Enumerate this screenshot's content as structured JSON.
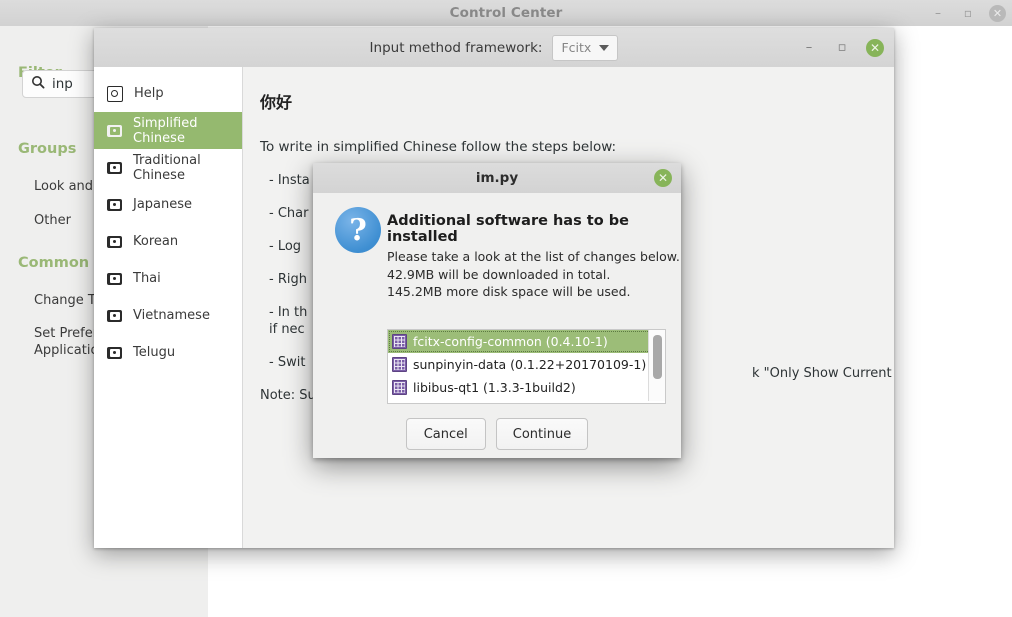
{
  "control_center": {
    "title": "Control Center",
    "window_controls": {
      "minimize": "–",
      "maximize": "▫",
      "close": "✕"
    },
    "sidebar": {
      "filter_label": "Filter",
      "search": {
        "icon": "search-icon",
        "value": "inp",
        "placeholder": ""
      },
      "groups_label": "Groups",
      "group_items": [
        {
          "label": "Look and F"
        },
        {
          "label": "Other"
        }
      ],
      "common_label": "Common T",
      "common_items": [
        {
          "label": "Change Th"
        },
        {
          "label": "Set Prefer"
        },
        {
          "label": "Applicatio"
        }
      ]
    }
  },
  "im_window": {
    "titlebar": {
      "label": "Input method framework:",
      "combo_value": "Fcitx",
      "combo_icon": "chevron-down-icon",
      "minimize": "–",
      "maximize": "▫",
      "close": "✕"
    },
    "languages": [
      {
        "label": "Help",
        "icon": "help-icon",
        "selected": false
      },
      {
        "label": "Simplified Chinese",
        "icon": "input-method-icon",
        "selected": true
      },
      {
        "label": "Traditional Chinese",
        "icon": "input-method-icon",
        "selected": false
      },
      {
        "label": "Japanese",
        "icon": "input-method-icon",
        "selected": false
      },
      {
        "label": "Korean",
        "icon": "input-method-icon",
        "selected": false
      },
      {
        "label": "Thai",
        "icon": "input-method-icon",
        "selected": false
      },
      {
        "label": "Vietnamese",
        "icon": "input-method-icon",
        "selected": false
      },
      {
        "label": "Telugu",
        "icon": "input-method-icon",
        "selected": false
      }
    ],
    "content": {
      "heading": "你好",
      "intro": "To write in simplified Chinese follow the steps below:",
      "steps": [
        "- Insta",
        "- Char",
        "- Log ",
        "- Righ",
        "- In th",
        "if nec",
        "- Swit"
      ],
      "step_right_fragment": "k \"Only Show Current Language\"",
      "note": "Note: Su"
    }
  },
  "dialog": {
    "title": "im.py",
    "close": "✕",
    "icon": "question-icon",
    "icon_glyph": "?",
    "heading": "Additional software has to be installed",
    "lines": [
      "Please take a look at the list of changes below.",
      "42.9MB will be downloaded in total.",
      "145.2MB more disk space will be used."
    ],
    "packages": [
      {
        "name": "fcitx-config-common (0.4.10-1)",
        "icon": "package-icon",
        "selected": true
      },
      {
        "name": "sunpinyin-data (0.1.22+20170109-1)",
        "icon": "package-icon",
        "selected": false
      },
      {
        "name": "libibus-qt1 (1.3.3-1build2)",
        "icon": "package-icon",
        "selected": false
      }
    ],
    "buttons": {
      "cancel": "Cancel",
      "continue": "Continue"
    }
  },
  "colors": {
    "accent_green": "#95b96f",
    "close_green": "#87b459",
    "section_green": "#9ab876",
    "package_purple": "#7b5ea8",
    "question_blue": "#3f8fd2"
  }
}
